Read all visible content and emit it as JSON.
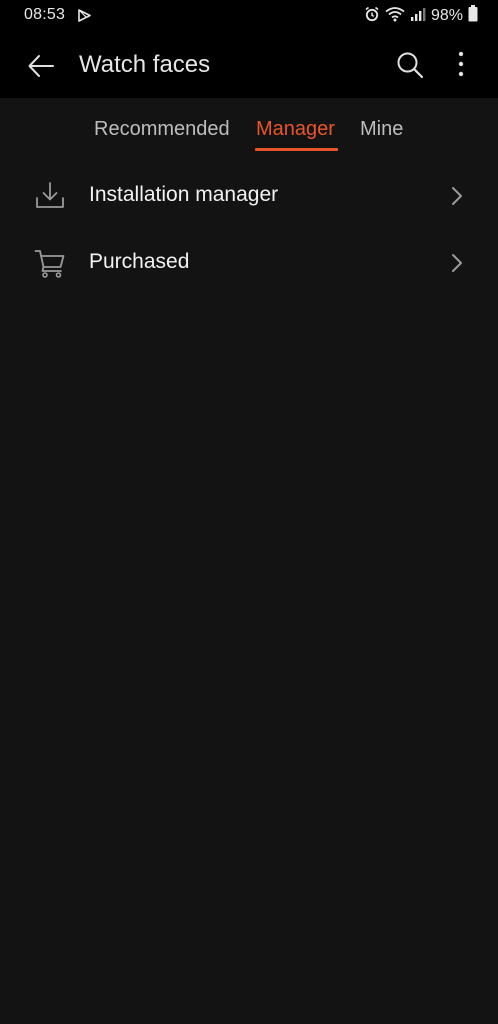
{
  "status_bar": {
    "time": "08:53",
    "battery_percent": "98%",
    "icons": [
      "play-store-icon",
      "alarm-icon",
      "wifi-icon",
      "signal-icon",
      "battery-icon"
    ]
  },
  "app_bar": {
    "title": "Watch faces",
    "icons": [
      "back-arrow-icon",
      "search-icon",
      "more-vert-icon"
    ]
  },
  "tabs": [
    {
      "label": "Recommended",
      "selected": false
    },
    {
      "label": "Manager",
      "selected": true
    },
    {
      "label": "Mine",
      "selected": false
    }
  ],
  "list": [
    {
      "label": "Installation manager",
      "icon": "download-icon"
    },
    {
      "label": "Purchased",
      "icon": "cart-icon"
    }
  ],
  "colors": {
    "background": "#131313",
    "bars": "#000000",
    "accent": "#e9552a",
    "text": "#f2f2f2",
    "muted": "#bdbdbd"
  }
}
